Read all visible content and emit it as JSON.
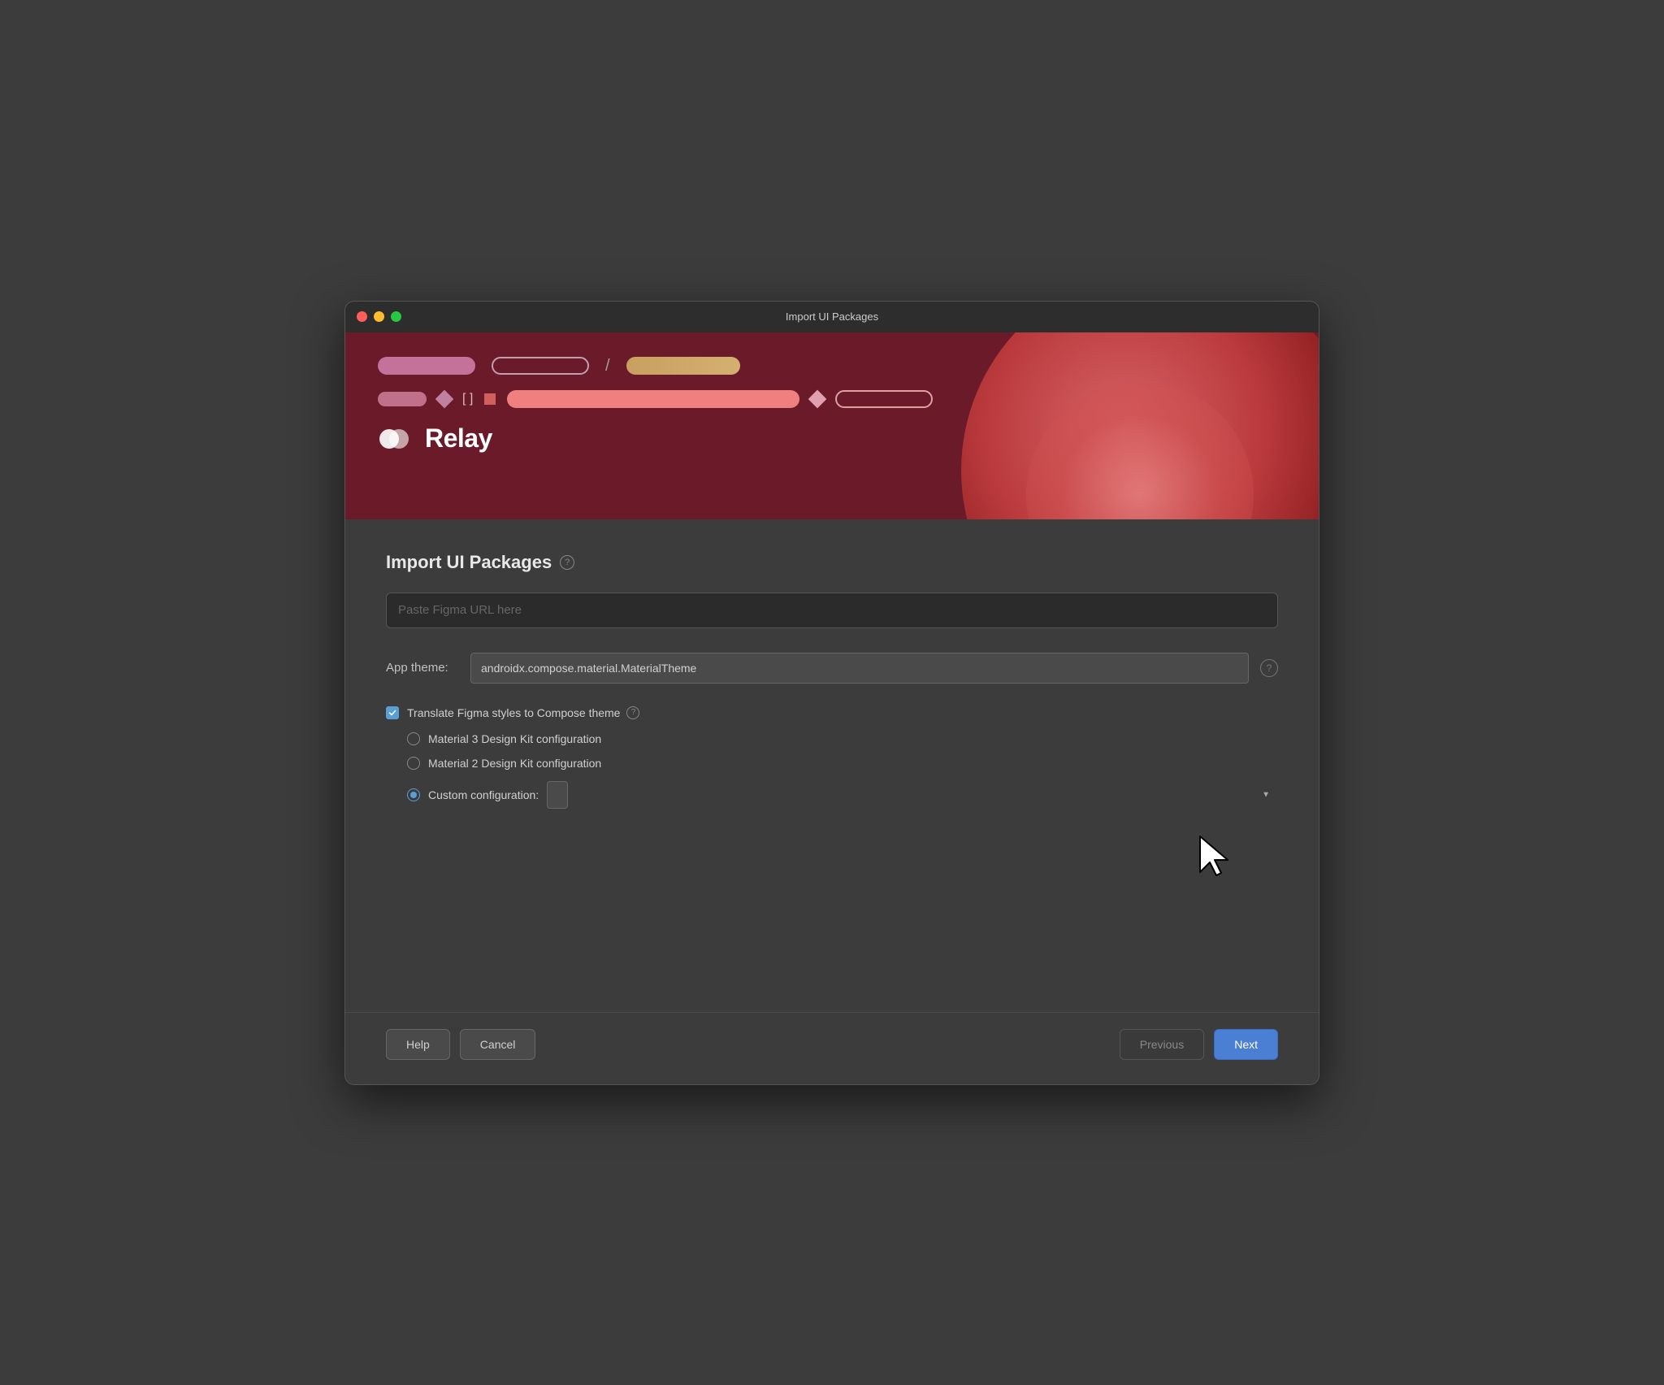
{
  "window": {
    "title": "Import UI Packages"
  },
  "hero": {
    "relay_logo_text": "Relay"
  },
  "main": {
    "section_title": "Import UI Packages",
    "help_label": "?",
    "url_input_placeholder": "Paste Figma URL here",
    "app_theme_label": "App theme:",
    "app_theme_value": "androidx.compose.material.MaterialTheme",
    "app_theme_help": "?",
    "translate_checkbox_label": "Translate Figma styles to Compose theme",
    "translate_checkbox_help": "?",
    "radio_material3_label": "Material 3 Design Kit configuration",
    "radio_material2_label": "Material 2 Design Kit configuration",
    "radio_custom_label": "Custom configuration:"
  },
  "footer": {
    "help_label": "Help",
    "cancel_label": "Cancel",
    "previous_label": "Previous",
    "next_label": "Next"
  }
}
